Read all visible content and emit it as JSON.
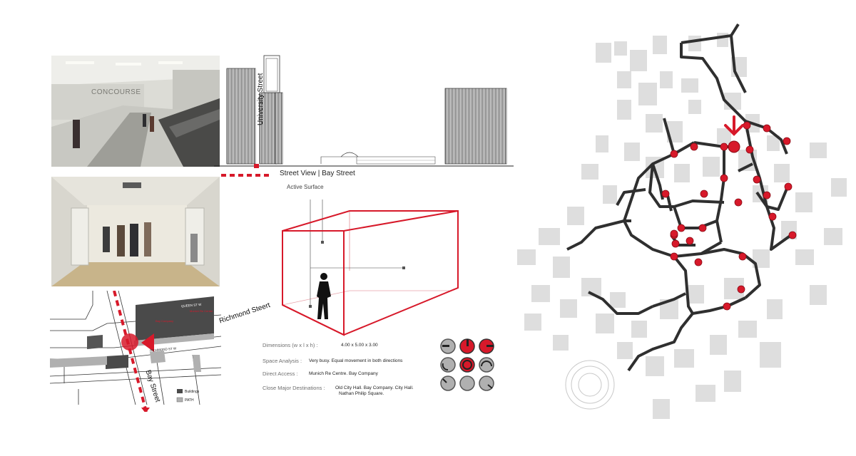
{
  "elevation": {
    "street_label": "University Street",
    "caption": "Street View | Bay Street"
  },
  "photos": {
    "concourse_sign": "CONCOURSE"
  },
  "active_surface": {
    "label": "Active Surface"
  },
  "site_map": {
    "richmond_label": "Richmond Steert",
    "bay_label": "Bay Street",
    "queen_label": "QUEEN ST W",
    "richmond_small": "RICHMOND ST W",
    "legend": [
      {
        "label": "Buildings",
        "color": "#4a4a4a"
      },
      {
        "label": "PATH",
        "color": "#b0b0b0"
      }
    ]
  },
  "specs": [
    {
      "label": "Dimensions (w x l x h) :",
      "value": "4.00 x 5.00 x 3.00"
    },
    {
      "label": "Space Analysis :",
      "value": "Very busy. Equal movement in both directions"
    },
    {
      "label": "Direct Access :",
      "value": "Munich Re Centre.  Bay Company"
    },
    {
      "label": "Close Major  Destinations :",
      "value": "Old City Hall. Bay Company. City Hall.",
      "value2": "Nathan Philip Square."
    }
  ],
  "colors": {
    "accent": "#d7192a",
    "path": "#2f2f2f",
    "building": "#dedede"
  }
}
